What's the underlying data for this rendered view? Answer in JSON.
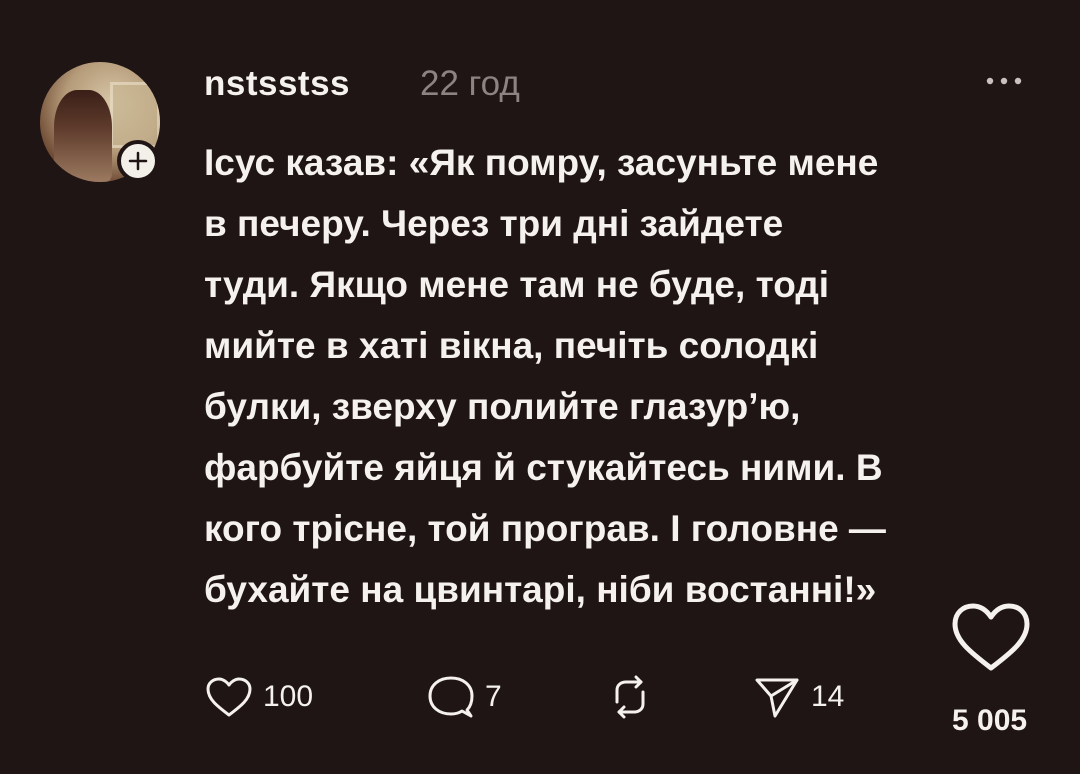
{
  "post": {
    "username": "nstsstss",
    "timestamp": "22 год",
    "lines": [
      "Ісус казав: «Як помру, засуньте мене",
      "в печеру. Через три дні зайдете",
      "туди. Якщо мене там не буде, тоді",
      "мийте в хаті вікна, печіть солодкі",
      "булки, зверху полийте глазур’ю,",
      "фарбуйте яйця й стукайтесь ними. В",
      "кого трісне, той програв. І головне —",
      "бухайте на цвинтарі, ніби востанні!»"
    ]
  },
  "actions": {
    "likes": "100",
    "replies": "7",
    "reposts": "",
    "shares": "14"
  },
  "views": "5 005",
  "colors": {
    "background": "#201515",
    "text": "#f4f1ee",
    "muted": "#8d8381"
  },
  "icons": [
    "plus-icon",
    "more-icon",
    "heart-icon",
    "comment-icon",
    "repost-icon",
    "share-icon"
  ]
}
